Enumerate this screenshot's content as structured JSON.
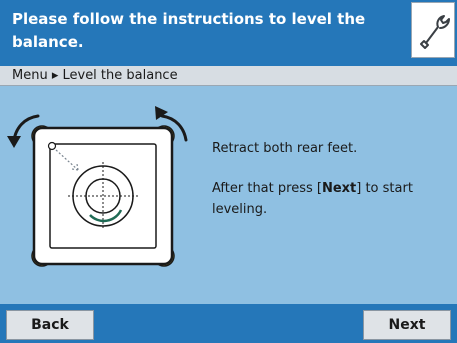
{
  "header": {
    "title": "Please follow the instructions to level the balance.",
    "settings_icon": "wrench-icon"
  },
  "breadcrumb": {
    "text": "Menu ▸ Level the balance"
  },
  "instructions": {
    "line1": "Retract both rear feet.",
    "line2_before": "After that press [",
    "line2_bold": "Next",
    "line2_after": "] to start leveling."
  },
  "footer": {
    "back_label": "Back",
    "next_label": "Next"
  },
  "colors": {
    "header_blue": "#2577b9",
    "content_bg": "#8fc0e2",
    "foot_yellow": "#f6d31c"
  }
}
